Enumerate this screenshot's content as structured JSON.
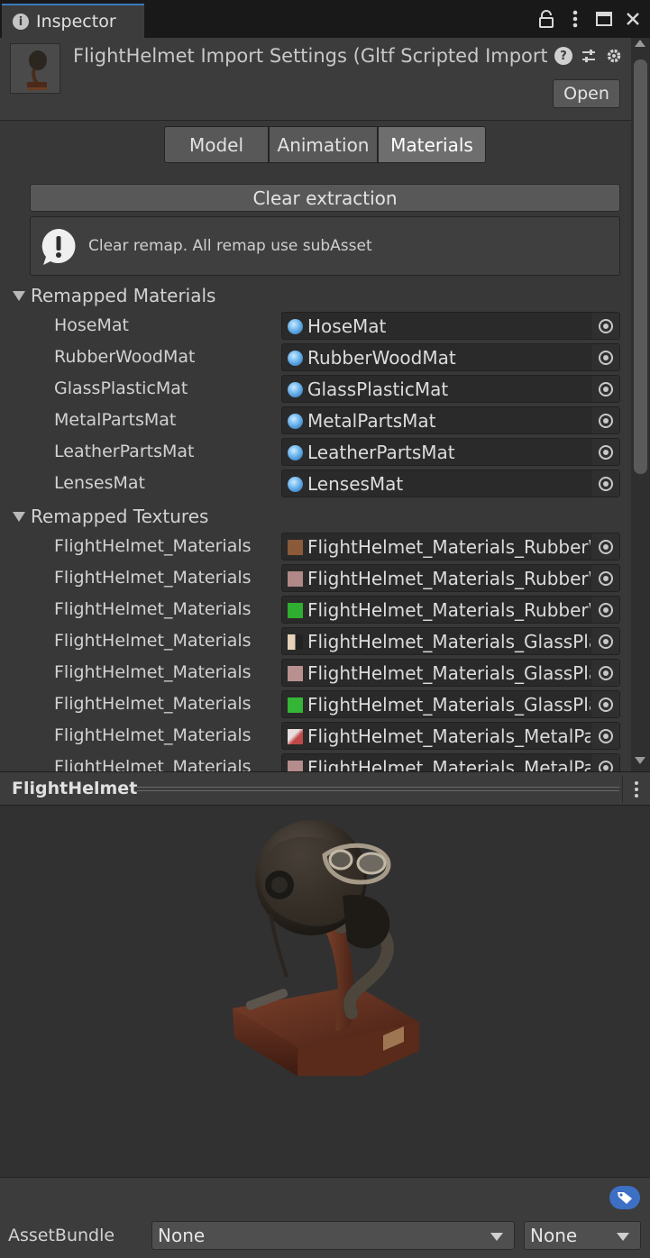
{
  "window": {
    "tab_label": "Inspector"
  },
  "header": {
    "title": "FlightHelmet Import Settings (Gltf Scripted Importer)",
    "open_label": "Open"
  },
  "tabs": [
    {
      "label": "Model",
      "active": false
    },
    {
      "label": "Animation",
      "active": false
    },
    {
      "label": "Materials",
      "active": true
    }
  ],
  "materials_panel": {
    "clear_extraction_label": "Clear extraction",
    "help_text": "Clear remap. All remap use subAsset",
    "remapped_materials_label": "Remapped Materials",
    "remapped_materials": [
      {
        "label": "HoseMat",
        "value": "HoseMat"
      },
      {
        "label": "RubberWoodMat",
        "value": "RubberWoodMat"
      },
      {
        "label": "GlassPlasticMat",
        "value": "GlassPlasticMat"
      },
      {
        "label": "MetalPartsMat",
        "value": "MetalPartsMat"
      },
      {
        "label": "LeatherPartsMat",
        "value": "LeatherPartsMat"
      },
      {
        "label": "LensesMat",
        "value": "LensesMat"
      }
    ],
    "remapped_textures_label": "Remapped Textures",
    "remapped_textures": [
      {
        "label": "FlightHelmet_Materials",
        "value": "FlightHelmet_Materials_RubberWoodMat",
        "swatch": "#8a5a3a"
      },
      {
        "label": "FlightHelmet_Materials",
        "value": "FlightHelmet_Materials_RubberWoodMat",
        "swatch": "#b08888"
      },
      {
        "label": "FlightHelmet_Materials",
        "value": "FlightHelmet_Materials_RubberWoodMat",
        "swatch": "#2fae2f"
      },
      {
        "label": "FlightHelmet_Materials",
        "value": "FlightHelmet_Materials_GlassPlasticMat",
        "swatch": "#d8c2a8"
      },
      {
        "label": "FlightHelmet_Materials",
        "value": "FlightHelmet_Materials_GlassPlasticMat",
        "swatch": "#b89090"
      },
      {
        "label": "FlightHelmet_Materials",
        "value": "FlightHelmet_Materials_GlassPlasticMat",
        "swatch": "#35b535"
      },
      {
        "label": "FlightHelmet_Materials",
        "value": "FlightHelmet_Materials_MetalPartsMat",
        "swatch": "#c9a4a4"
      },
      {
        "label": "FlightHelmet_Materials",
        "value": "FlightHelmet_Materials_MetalPartsMat",
        "swatch": "#b58c8c"
      }
    ]
  },
  "preview": {
    "title": "FlightHelmet"
  },
  "asset_bundle": {
    "label": "AssetBundle",
    "name_value": "None",
    "variant_value": "None"
  },
  "colors": {
    "accent": "#3a79bb",
    "tag": "#3d6fc4"
  }
}
